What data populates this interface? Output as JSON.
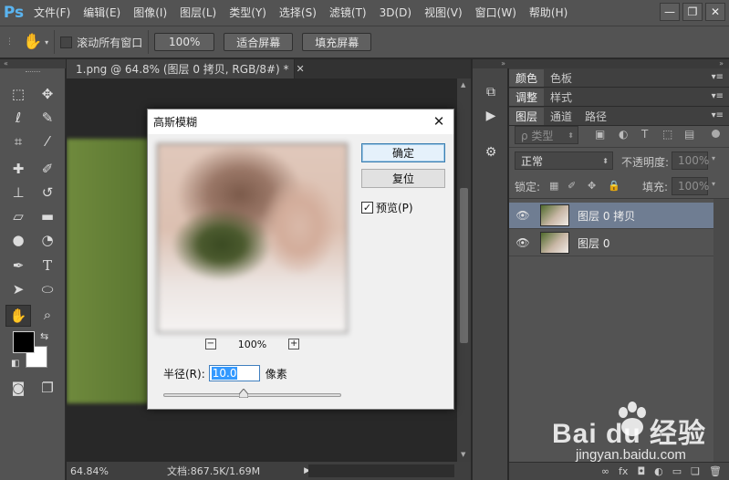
{
  "app": {
    "logo": "Ps"
  },
  "menubar": {
    "items": [
      "文件(F)",
      "编辑(E)",
      "图像(I)",
      "图层(L)",
      "类型(Y)",
      "选择(S)",
      "滤镜(T)",
      "3D(D)",
      "视图(V)",
      "窗口(W)",
      "帮助(H)"
    ],
    "window_controls": {
      "minimize": "—",
      "restore": "❐",
      "close": "✕"
    }
  },
  "optionsbar": {
    "tool_icon": "hand-icon",
    "scroll_all_label": "滚动所有窗口",
    "btn_zoom": "100%",
    "btn_fit": "适合屏幕",
    "btn_fill": "填充屏幕"
  },
  "document": {
    "tab_title": "1.png @ 64.8% (图层 0 拷贝, RGB/8#) *",
    "status_zoom": "64.84%",
    "status_doc": "文档:867.5K/1.69M"
  },
  "panels": {
    "top_tabs": [
      "颜色",
      "色板"
    ],
    "mid_tabs": [
      "调整",
      "样式"
    ],
    "layer_tabs": [
      "图层",
      "通道",
      "路径"
    ],
    "filter_kind": "ρ 类型",
    "blend_mode": "正常",
    "opacity_label": "不透明度:",
    "opacity_value": "100%",
    "lock_label": "锁定:",
    "fill_label": "填充:",
    "fill_value": "100%",
    "layers": [
      {
        "name": "图层 0 拷贝",
        "selected": true
      },
      {
        "name": "图层 0",
        "selected": false
      }
    ]
  },
  "dialog": {
    "title": "高斯模糊",
    "ok_label": "确定",
    "reset_label": "复位",
    "preview_label": "预览(P)",
    "preview_checked": true,
    "zoom_value": "100%",
    "radius_label": "半径(R):",
    "radius_value": "10.0",
    "radius_unit": "像素",
    "slider_position": 0.45
  },
  "watermark": {
    "text": "Bai du 经验",
    "url": "jingyan.baidu.com"
  },
  "colors": {
    "menubar_bg": "#535353",
    "workspace_bg": "#282828",
    "selected_layer": "#6f7d92",
    "default_button_border": "#3c7fb1",
    "logo": "#5ab4f0"
  }
}
